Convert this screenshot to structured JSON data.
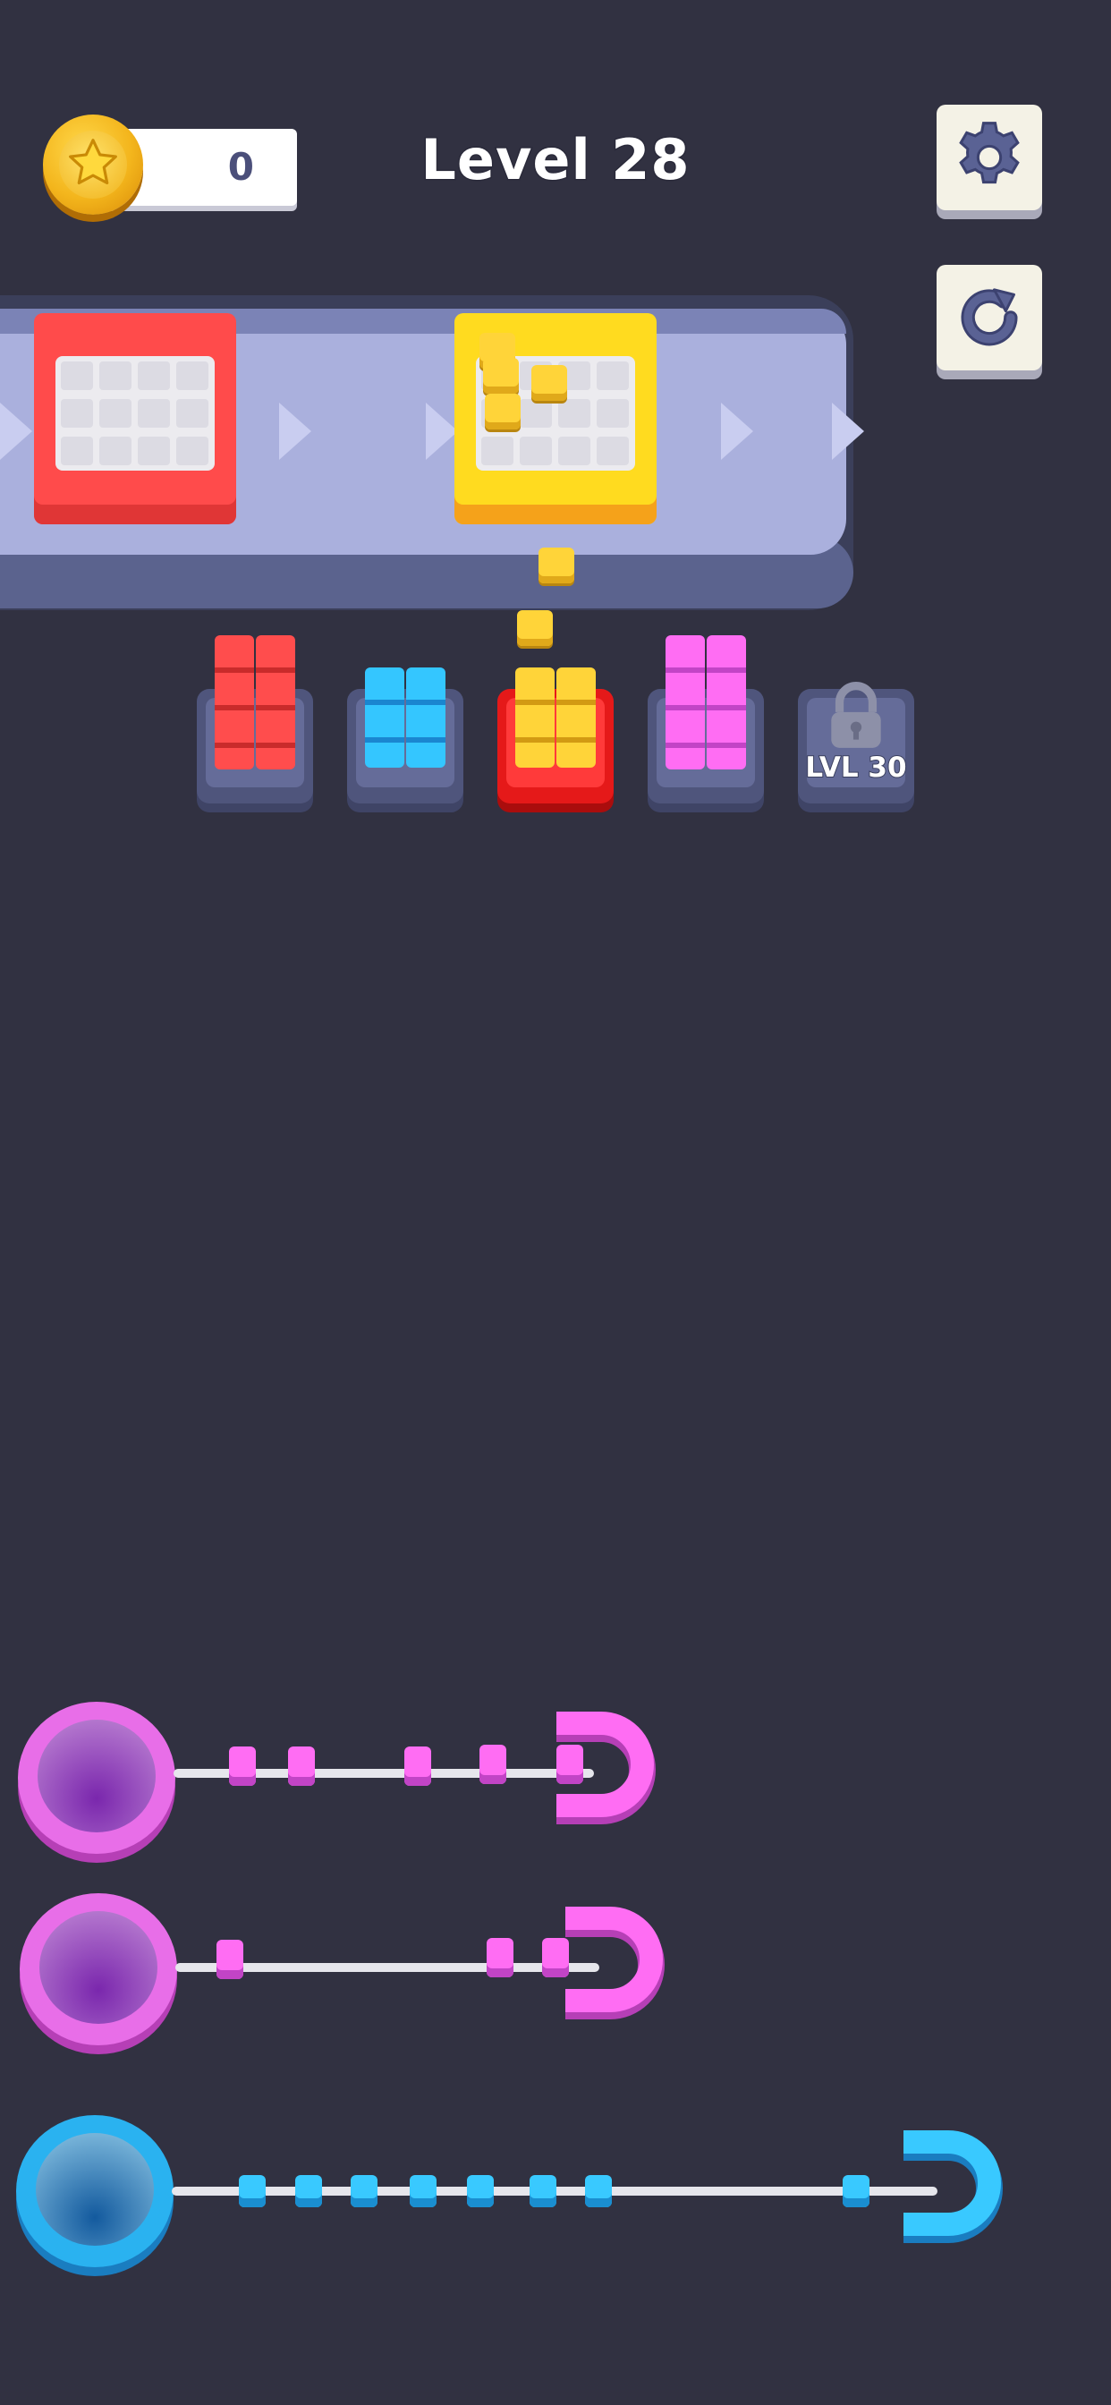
{
  "hud": {
    "coins": "0",
    "level_title": "Level 28",
    "settings_icon": "gear-icon",
    "restart_icon": "restart-icon",
    "coin_icon": "star-coin-icon"
  },
  "conveyor": {
    "boxes": [
      {
        "color": "#ff4b4b",
        "state": "empty"
      },
      {
        "color": "#ffdb1f",
        "state": "filling"
      }
    ]
  },
  "slots": [
    {
      "color": "#ff4d4d",
      "state": "filled"
    },
    {
      "color": "#34c6ff",
      "state": "filled"
    },
    {
      "color": "#ffd439",
      "state": "active"
    },
    {
      "color": "#ff6df3",
      "state": "filled"
    },
    {
      "state": "locked",
      "lock_label": "LVL 30",
      "icon": "lock-icon"
    }
  ],
  "pull_lines": [
    {
      "color": "#ff6df3",
      "bead_count": 5
    },
    {
      "color": "#ff6df3",
      "bead_count": 3
    },
    {
      "color": "#39c9ff",
      "bead_count": 8
    }
  ]
}
